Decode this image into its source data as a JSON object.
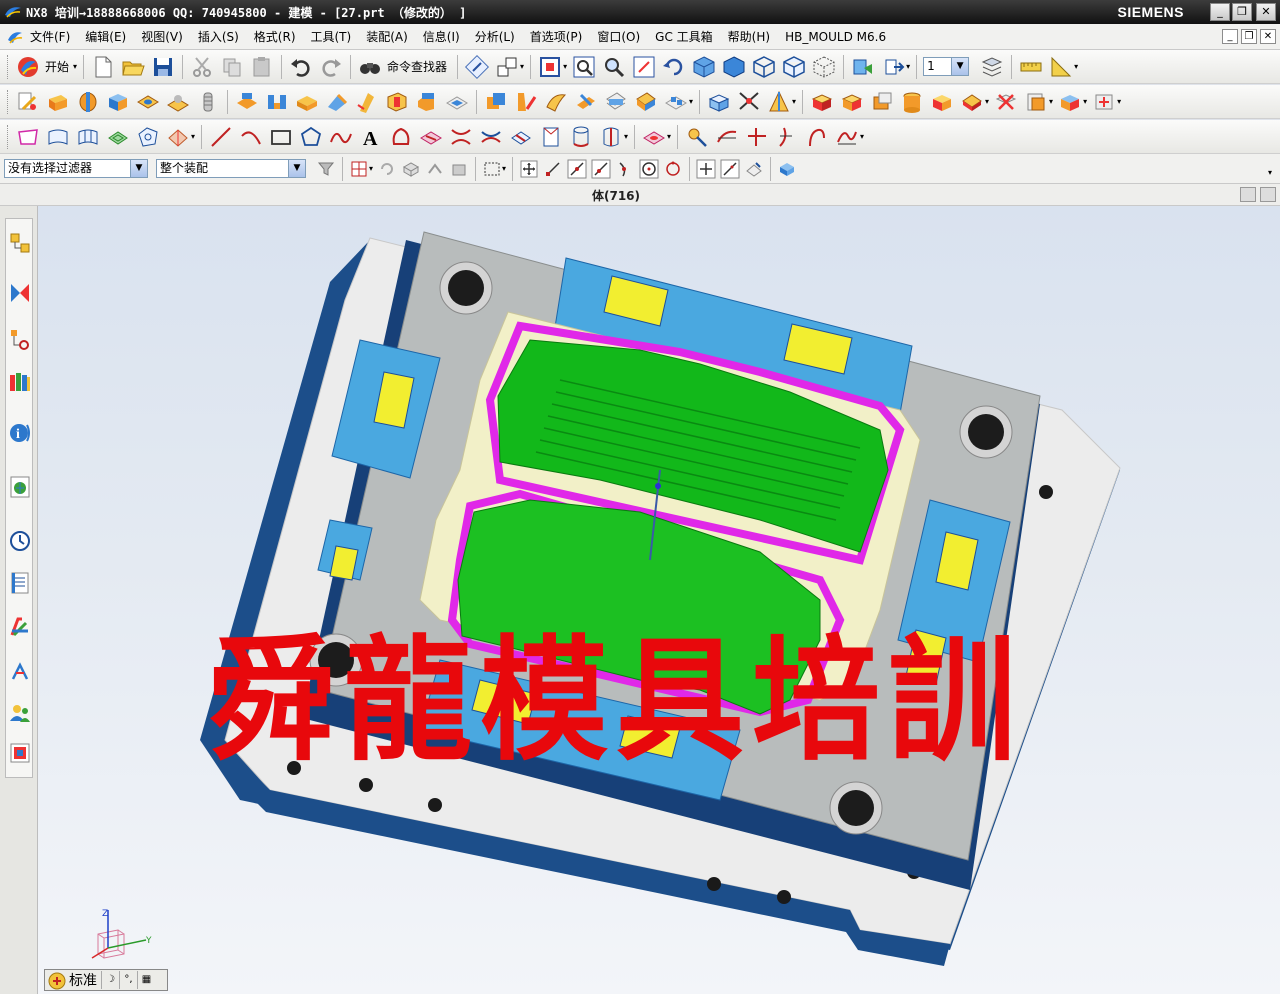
{
  "window": {
    "title": "NX8 培训→18888668006 QQ: 740945800 - 建模 - [27.prt （修改的） ]",
    "brand": "SIEMENS"
  },
  "menu": {
    "items": [
      "文件(F)",
      "编辑(E)",
      "视图(V)",
      "插入(S)",
      "格式(R)",
      "工具(T)",
      "装配(A)",
      "信息(I)",
      "分析(L)",
      "首选项(P)",
      "窗口(O)",
      "GC 工具箱",
      "帮助(H)",
      "HB_MOULD M6.6"
    ]
  },
  "toolbar1": {
    "start_label": "开始",
    "command_finder_label": "命令查找器",
    "layer_value": "1"
  },
  "filterbar": {
    "selection_filter": "没有选择过滤器",
    "assembly_scope": "整个装配"
  },
  "status": {
    "selection_text": "体(716)"
  },
  "viewport": {
    "watermark": "舜龍模具培訓",
    "triad_labels": {
      "z": "Z",
      "y": "Y"
    }
  },
  "view_toolbar": {
    "label": "标准"
  },
  "colors": {
    "plate": "#eeeeee",
    "plate_edge": "#1c4e8a",
    "insert_blue": "#4aa8e0",
    "core_cream": "#f2f0c8",
    "part_green": "#12b81a",
    "parting_magenta": "#e028e8",
    "label_yellow": "#f2ee30",
    "watermark": "#e8080c"
  }
}
